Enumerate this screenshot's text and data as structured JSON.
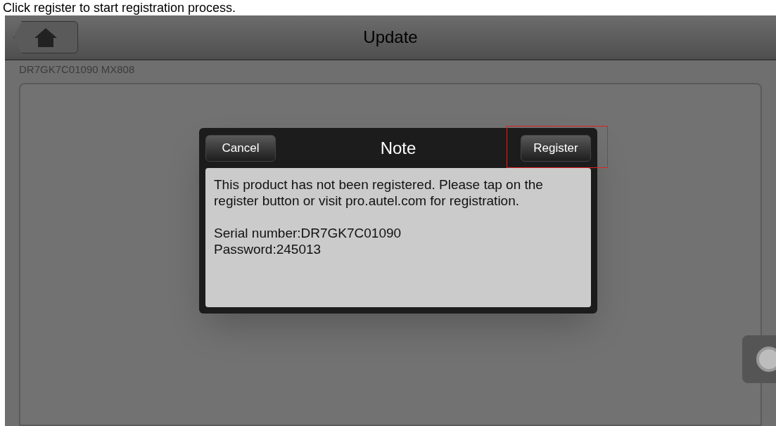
{
  "caption": "Click register to start registration process.",
  "header": {
    "title": "Update"
  },
  "device_info": "DR7GK7C01090  MX808",
  "dialog": {
    "title": "Note",
    "cancel": "Cancel",
    "confirm": "Register",
    "confirm_highlighted": true,
    "message": "This product has not been registered. Please tap on the register button or visit pro.autel.com for registration.",
    "details": [
      "Serial number:DR7GK7C01090",
      "Password:245013"
    ]
  }
}
